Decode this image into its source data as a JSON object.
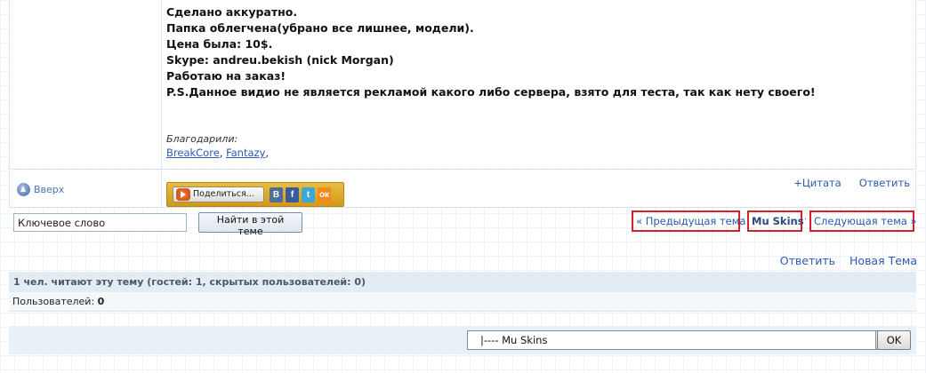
{
  "post": {
    "lines": [
      "Сделано аккуратно.",
      "Папка облегчена(убрано все лишнее, модели).",
      "Цена была: 10$.",
      "Skype: andreu.bekish (nick Morgan)",
      "Работаю на заказ!",
      "P.S.Данное видио не является рекламой какого либо сервера, взято для теста, так как нету своего!"
    ],
    "thanks_label": "Благодарили:",
    "thanks_users": [
      "BreakCore",
      "Fantazy"
    ],
    "thanks_separator": ", ",
    "thanks_trailing": ","
  },
  "post_footer": {
    "up_label": "Вверх",
    "share_label": "Поделиться...",
    "social": {
      "vk": "В",
      "fb": "f",
      "tw": "t",
      "ok": "ок"
    },
    "quote_label": "+Цитата",
    "reply_label": "Ответить"
  },
  "search": {
    "value": "Ключевое слово",
    "button_label": "Найти в этой теме"
  },
  "topic_nav": {
    "prev": "« Предыдущая тема",
    "current": "Mu Skins",
    "next": "Следующая тема »",
    "separator": "·"
  },
  "bottom_actions": {
    "reply": "Ответить",
    "new_topic": "Новая Тема"
  },
  "stats": {
    "readers": "1 чел. читают эту тему (гостей: 1, скрытых пользователей: 0)",
    "users_label": "Пользователей:",
    "users_count": "0"
  },
  "jump": {
    "selected": "|---- Mu Skins",
    "ok_label": "OK"
  }
}
